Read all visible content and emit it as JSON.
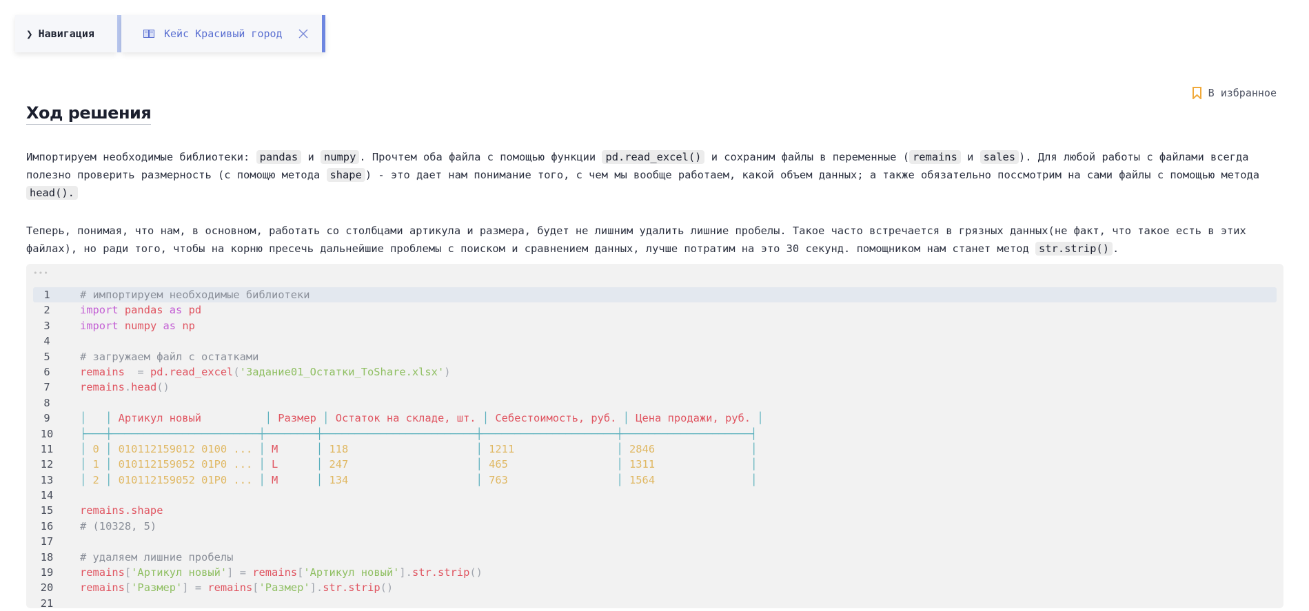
{
  "tabs": {
    "nav_label": "Навигация",
    "case_label": "Кейс Красивый город"
  },
  "favorite_label": "В избранное",
  "heading": "Ход решения",
  "paragraph1": {
    "t1": "Импортируем необходимые библиотеки: ",
    "c1": "pandas",
    "t2": " и ",
    "c2": "numpy",
    "t3": ". Прочтем оба файла с помощью функции ",
    "c3": "pd.read_excel()",
    "t4": " и сохраним файлы в переменные (",
    "c4": "remains",
    "t5": " и ",
    "c5": "sales",
    "t6": "). Для любой работы с файлами всегда полезно проверить размерность (с помощю метода ",
    "c6": "shape",
    "t7": ") - это дает нам понимание того, с чем мы вообще работаем, какой объем данных; а также обязательно поссмотрим на сами файлы с помощью метода ",
    "c7": "head()."
  },
  "paragraph2": {
    "t1": "Теперь, понимая, что нам, в основном, работать со столбцами артикула и размера, будет не лишним удалить лишние пробелы. Такое часто встречается в грязных данных(не факт, что такое есть в этих файлах), но ради того, чтобы на корню пресечь дальнейшие проблемы с поиском и сравнением данных, лучше потратим на это 30 секунд. помощником нам станет метод ",
    "c1": "str.strip()",
    "t2": "."
  },
  "code": {
    "dots": "•••",
    "line_numbers": [
      "1",
      "2",
      "3",
      "4",
      "5",
      "6",
      "7",
      "8",
      "9",
      "10",
      "11",
      "12",
      "13",
      "14",
      "15",
      "16",
      "17",
      "18",
      "19",
      "20",
      "21"
    ],
    "l1_comment": "# импортируем необходимые библиотеки",
    "kw_import": "import",
    "kw_as": "as",
    "l2_mod": "pandas",
    "l2_alias": "pd",
    "l3_mod": "numpy",
    "l3_alias": "np",
    "l5_comment": "# загружаем файл с остатками",
    "l6_var": "remains",
    "l6_eq": "  = ",
    "l6_call": "pd.read_excel",
    "l6_open": "(",
    "l6_str": "'Задание01_Остатки_ToShare.xlsx'",
    "l6_close": ")",
    "l7_var": "remains",
    "l7_dot": ".",
    "l7_call": "head",
    "l7_paren": "()",
    "table": {
      "headers": [
        "",
        "Артикул новый",
        "Размер",
        "Остаток на складе, шт.",
        "Себестоимость, руб.",
        "Цена продажи, руб."
      ],
      "rows": [
        [
          "0",
          "010112159012 0100 ...",
          "M",
          "118",
          "1211",
          "2846"
        ],
        [
          "1",
          "010112159052 01P0 ...",
          "L",
          "247",
          "465",
          "1311"
        ],
        [
          "2",
          "010112159052 01P0 ...",
          "M",
          "134",
          "763",
          "1564"
        ]
      ]
    },
    "l15": "remains.shape",
    "l16": "# (10328, 5)",
    "l18_comment": "# удаляем лишние пробелы",
    "l19_var": "remains",
    "l19_key": "'Артикул новый'",
    "l19_method": "str.strip",
    "l20_var": "remains",
    "l20_key": "'Размер'",
    "l20_method": "str.strip"
  }
}
